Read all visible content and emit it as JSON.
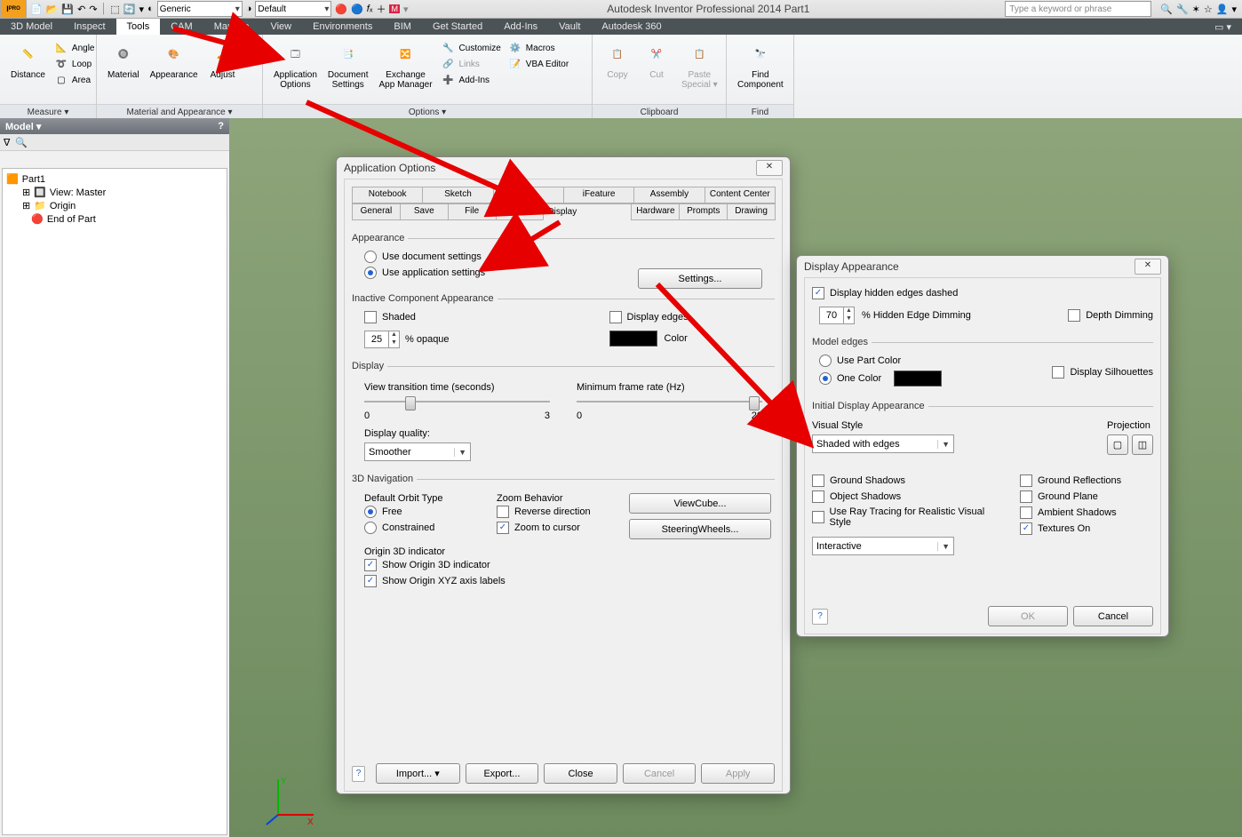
{
  "title": "Autodesk Inventor Professional 2014  Part1",
  "search_placeholder": "Type a keyword or phrase",
  "qat": {
    "material_combo": "Generic",
    "appearance_combo": "Default"
  },
  "ribbonTabs": [
    "3D Model",
    "Inspect",
    "Tools",
    "CAM",
    "Manage",
    "View",
    "Environments",
    "BIM",
    "Get Started",
    "Add-Ins",
    "Vault",
    "Autodesk 360"
  ],
  "ribbon_active_tab": 2,
  "ribbon": {
    "measure": {
      "cap": "Measure ▾",
      "big": "Distance",
      "small": [
        "Angle",
        "Loop",
        "Area"
      ]
    },
    "matapp": {
      "cap": "Material and Appearance ▾",
      "material": "Material",
      "appearance": "Appearance",
      "adjust": "Adjust"
    },
    "options": {
      "cap": "Options ▾",
      "appopt": "Application\nOptions",
      "docset": "Document\nSettings",
      "exchange": "Exchange\nApp Manager",
      "customize": "Customize",
      "links": "Links",
      "addins": "Add-Ins",
      "macros": "Macros",
      "vba": "VBA Editor"
    },
    "clipboard": {
      "cap": "Clipboard",
      "copy": "Copy",
      "cut": "Cut",
      "paste": "Paste\nSpecial ▾"
    },
    "find": {
      "cap": "Find",
      "find": "Find\nComponent"
    }
  },
  "browser": {
    "title": "Model ▾",
    "root": "Part1",
    "nodes": [
      "View: Master",
      "Origin",
      "End of Part"
    ]
  },
  "dlg_appopt": {
    "title": "Application Options",
    "tabs_top": [
      "Notebook",
      "Sketch",
      "Part",
      "iFeature",
      "Assembly",
      "Content Center"
    ],
    "tabs_bot": [
      "General",
      "Save",
      "File",
      "Colors",
      "Display",
      "Hardware",
      "Prompts",
      "Drawing"
    ],
    "active_tab": "Display",
    "appearance": {
      "legend": "Appearance",
      "use_doc": "Use document settings",
      "use_app": "Use application settings",
      "settings_btn": "Settings..."
    },
    "inactive": {
      "legend": "Inactive Component Appearance",
      "shaded": "Shaded",
      "opaque_val": "25",
      "opaque_lbl": "% opaque",
      "display_edges": "Display edges",
      "color_lbl": "Color"
    },
    "display": {
      "legend": "Display",
      "transition_lbl": "View transition time (seconds)",
      "transition_min": "0",
      "transition_max": "3",
      "framerate_lbl": "Minimum frame rate (Hz)",
      "framerate_min": "0",
      "framerate_max": "20",
      "quality_lbl": "Display quality:",
      "quality_val": "Smoother"
    },
    "nav": {
      "legend": "3D Navigation",
      "orbit_lbl": "Default Orbit Type",
      "orbit_free": "Free",
      "orbit_constrained": "Constrained",
      "zoom_lbl": "Zoom Behavior",
      "reverse": "Reverse direction",
      "zoom_cursor": "Zoom to cursor",
      "viewcube": "ViewCube...",
      "steering": "SteeringWheels...",
      "origin_lbl": "Origin 3D indicator",
      "show_origin": "Show Origin 3D indicator",
      "show_xyz": "Show Origin XYZ axis labels"
    },
    "buttons": {
      "import": "Import...  ▾",
      "export": "Export...",
      "close": "Close",
      "cancel": "Cancel",
      "apply": "Apply"
    }
  },
  "dlg_disp": {
    "title": "Display Appearance",
    "hidden_dashed": "Display hidden edges dashed",
    "hidden_val": "70",
    "hidden_lbl": "% Hidden Edge Dimming",
    "depth_dim": "Depth Dimming",
    "model_edges": "Model edges",
    "use_part_color": "Use Part Color",
    "one_color": "One Color",
    "silhouettes": "Display Silhouettes",
    "initial": "Initial Display Appearance",
    "visual_style": "Visual Style",
    "visual_style_val": "Shaded with edges",
    "projection": "Projection",
    "ground_shadows": "Ground Shadows",
    "object_shadows": "Object Shadows",
    "ray_tracing": "Use Ray Tracing for Realistic Visual Style",
    "ground_reflections": "Ground Reflections",
    "ground_plane": "Ground Plane",
    "ambient_shadows": "Ambient Shadows",
    "textures_on": "Textures On",
    "mode_val": "Interactive",
    "ok": "OK",
    "cancel": "Cancel"
  }
}
